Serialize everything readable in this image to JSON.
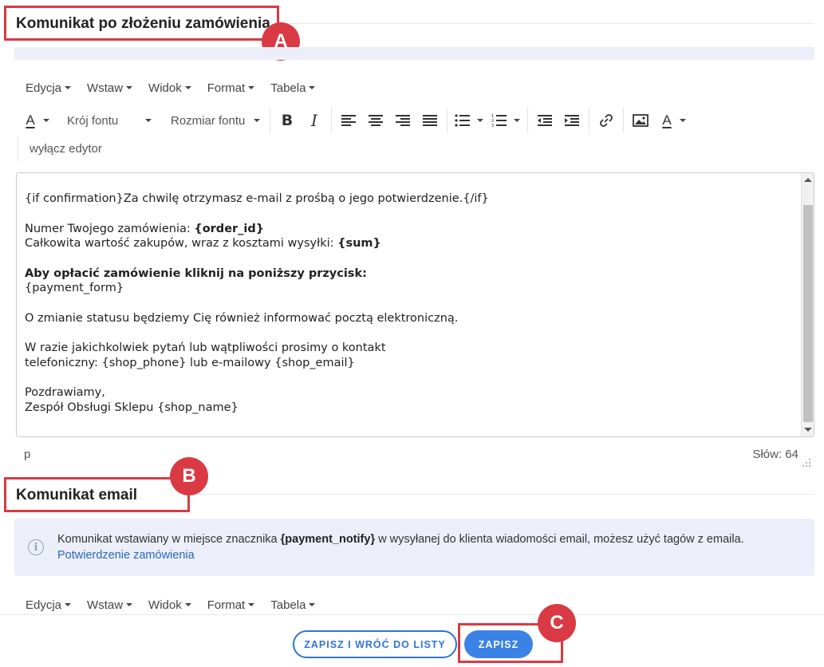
{
  "section1": {
    "title": "Komunikat po złożeniu zamówienia",
    "badge": "A"
  },
  "menubar": [
    {
      "label": "Edycja"
    },
    {
      "label": "Wstaw"
    },
    {
      "label": "Widok"
    },
    {
      "label": "Format"
    },
    {
      "label": "Tabela"
    }
  ],
  "toolbar": {
    "font_family_label": "Krój fontu",
    "font_size_label": "Rozmiar fontu",
    "bold_glyph": "B",
    "italic_glyph": "I",
    "text_color_glyph": "A",
    "disable_editor": "wyłącz edytor"
  },
  "editor": {
    "lines": {
      "l1": "{if confirmation}Za chwilę otrzymasz e-mail z prośbą o jego potwierdzenie.{/if}",
      "l2_prefix": "Numer Twojego zamówienia: ",
      "l2_tag": "{order_id}",
      "l3_prefix": "Całkowita wartość zakupów, wraz z kosztami wysyłki: ",
      "l3_tag": "{sum}",
      "l4": "Aby opłacić zamówienie kliknij na poniższy przycisk:",
      "l5": "{payment_form}",
      "l6": "O zmianie statusu będziemy Cię również informować pocztą elektroniczną.",
      "l7": "W razie jakichkolwiek pytań lub wątpliwości prosimy o kontakt",
      "l8": "telefoniczny: {shop_phone} lub e-mailowy {shop_email}",
      "l9": "Pozdrawiamy,",
      "l10": "Zespół Obsługi Sklepu {shop_name}"
    }
  },
  "statusbar": {
    "path": "p",
    "word_count": "Słów: 64"
  },
  "section2": {
    "title": "Komunikat email",
    "badge": "B"
  },
  "info": {
    "text_before": "Komunikat wstawiany w miejsce znacznika ",
    "tag": "{payment_notify}",
    "text_after": " w wysyłanej do klienta wiadomości email, możesz użyć tagów z emaila.",
    "link": "Potwierdzenie zamówienia"
  },
  "actions": {
    "save_back": "ZAPISZ I WRÓĆ DO LISTY",
    "save": "ZAPISZ",
    "badge": "C"
  },
  "colors": {
    "accent": "#3b82e6",
    "annotation_red": "#d93a44",
    "info_bg": "#eceff9"
  }
}
